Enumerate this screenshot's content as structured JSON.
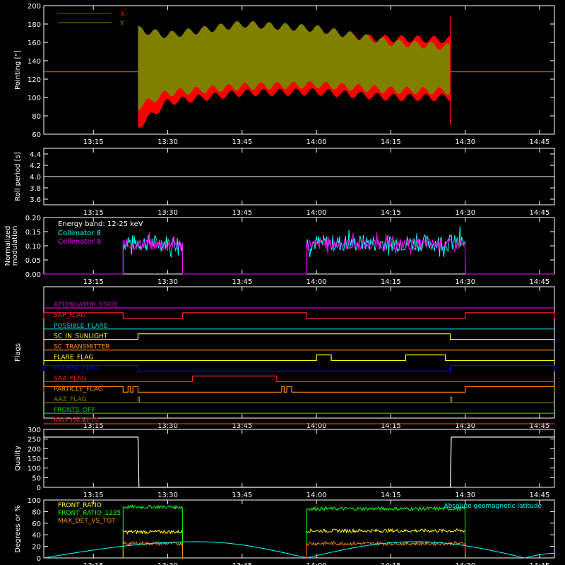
{
  "x_ticks": [
    "13:15",
    "13:30",
    "13:45",
    "14:00",
    "14:15",
    "14:30",
    "14:45"
  ],
  "chart_data": [
    {
      "type": "line",
      "ylabel": "Pointing [\"]",
      "xlim": [
        "13:05",
        "14:48"
      ],
      "ylim": [
        60,
        200
      ],
      "yticks": [
        60,
        80,
        100,
        120,
        140,
        160,
        180,
        200
      ],
      "legend_position": "top-left",
      "series": [
        {
          "name": "X",
          "color": "#ff0000",
          "baseline": 128,
          "active": [
            "13:24",
            "14:27"
          ],
          "envelope_upper": [
            [
              13.4,
              150
            ],
            [
              13.5,
              160
            ],
            [
              13.75,
              166
            ],
            [
              14.0,
              166
            ],
            [
              14.25,
              164
            ],
            [
              14.45,
              163
            ]
          ],
          "envelope_lower": [
            [
              13.4,
              68
            ],
            [
              13.5,
              95
            ],
            [
              13.75,
              105
            ],
            [
              14.0,
              106
            ],
            [
              14.25,
              100
            ],
            [
              14.45,
              100
            ]
          ]
        },
        {
          "name": "Y",
          "color": "#808000",
          "baseline": 128,
          "active": [
            "13:24",
            "14:27"
          ],
          "envelope_upper": [
            [
              13.4,
              174
            ],
            [
              13.5,
              168
            ],
            [
              13.75,
              180
            ],
            [
              14.0,
              175
            ],
            [
              14.25,
              160
            ],
            [
              14.45,
              155
            ]
          ],
          "envelope_lower": [
            [
              13.4,
              90
            ],
            [
              13.5,
              105
            ],
            [
              13.75,
              112
            ],
            [
              14.0,
              114
            ],
            [
              14.25,
              108
            ],
            [
              14.45,
              107
            ]
          ]
        }
      ]
    },
    {
      "type": "line",
      "ylabel": "Roll period [s]",
      "ylim": [
        3.5,
        4.5
      ],
      "yticks": [
        3.6,
        3.8,
        4.0,
        4.2,
        4.4
      ],
      "series": [
        {
          "name": "",
          "color": "#ffffff",
          "x": [
            "13:05",
            "14:48"
          ],
          "y": [
            4.0,
            4.0
          ]
        }
      ]
    },
    {
      "type": "line",
      "ylabel": "Normalized modulation",
      "ylim": [
        0,
        0.2
      ],
      "yticks": [
        0.0,
        0.05,
        0.1,
        0.15,
        0.2
      ],
      "annotation": "Energy band: 12-25 keV",
      "series": [
        {
          "name": "Collimator 8",
          "color": "#00ffff",
          "segments": [
            [
              "13:21",
              "13:33"
            ],
            [
              "13:58",
              "14:30"
            ]
          ],
          "level": 0.11,
          "spread": 0.03
        },
        {
          "name": "Collimator 9",
          "color": "#ff00ff",
          "segments": [
            [
              "13:21",
              "13:33"
            ],
            [
              "13:58",
              "14:30"
            ]
          ],
          "level": 0.105,
          "spread": 0.02
        }
      ]
    },
    {
      "type": "line",
      "ylabel": "Flags",
      "flags": [
        {
          "name": "ATTENUATOR_STATE",
          "color": "#cc00cc",
          "high": []
        },
        {
          "name": "SAP_FLAG",
          "color": "#ff2222",
          "high": [
            [
              "13:05",
              "13:21"
            ],
            [
              "13:33",
              "13:58"
            ],
            [
              "14:30",
              "14:48"
            ]
          ]
        },
        {
          "name": "POSSIBLE_FLARE",
          "color": "#00cccc",
          "high": []
        },
        {
          "name": "SC_IN_SUNLIGHT",
          "color": "#ffff00",
          "high": [
            [
              "13:24",
              "14:27"
            ]
          ]
        },
        {
          "name": "SC_TRANSMITTER",
          "color": "#ff8800",
          "high": []
        },
        {
          "name": "FLARE_FLAG",
          "color": "#ffff00",
          "high": [
            [
              "14:00",
              "14:03"
            ],
            [
              "14:18",
              "14:26"
            ]
          ]
        },
        {
          "name": "ECLIPSE_FLAG",
          "color": "#0000ff",
          "high": [
            [
              "13:05",
              "13:24"
            ],
            [
              "14:27",
              "14:48"
            ]
          ]
        },
        {
          "name": "SAA_FLAG",
          "color": "#ff2222",
          "high": [
            [
              "13:35",
              "13:52"
            ]
          ]
        },
        {
          "name": "PARTICLE_FLAG",
          "color": "#ff8800",
          "high": [
            [
              "13:05",
              "13:21"
            ],
            [
              "13:22",
              "13:22.5"
            ],
            [
              "13:23",
              "13:24"
            ],
            [
              "13:53",
              "13:53.5"
            ],
            [
              "13:54",
              "13:55"
            ],
            [
              "14:30",
              "14:48"
            ]
          ]
        },
        {
          "name": "AAZ_FLAG",
          "color": "#808000",
          "high": [
            [
              "13:24",
              "13:24.3"
            ],
            [
              "14:27",
              "14:27.3"
            ]
          ]
        },
        {
          "name": "FRONTS_OFF",
          "color": "#00cc00",
          "high": []
        },
        {
          "name": "BAD_PACKETS",
          "color": "#ff2222",
          "high": []
        }
      ]
    },
    {
      "type": "line",
      "ylabel": "Quality",
      "ylim": [
        0,
        300
      ],
      "yticks": [
        0,
        50,
        100,
        150,
        200,
        250,
        300
      ],
      "series": [
        {
          "name": "",
          "color": "#ffffff",
          "x": [
            "13:05",
            "13:24",
            "13:24.2",
            "14:27",
            "14:27.2",
            "14:48"
          ],
          "y": [
            260,
            260,
            0,
            0,
            260,
            260
          ]
        }
      ]
    },
    {
      "type": "line",
      "ylabel": "Degrees or %",
      "ylim": [
        0,
        100
      ],
      "yticks": [
        0,
        20,
        40,
        60,
        80,
        100
      ],
      "legend_position": "top-left",
      "annotation": "Absolute geomagnetic latitude",
      "series": [
        {
          "name": "FRONT_RATIO",
          "color": "#ffff00",
          "segments": [
            [
              "13:21",
              "13:33"
            ],
            [
              "13:58",
              "14:30"
            ]
          ],
          "levels": [
            45,
            47
          ]
        },
        {
          "name": "FRONT_RATIO_1225",
          "color": "#00ff00",
          "segments": [
            [
              "13:21",
              "13:33"
            ],
            [
              "13:58",
              "14:30"
            ]
          ],
          "levels": [
            88,
            85
          ]
        },
        {
          "name": "MAX_DET_VS_TOT",
          "color": "#ff8800",
          "segments": [
            [
              "13:21",
              "13:33"
            ],
            [
              "13:58",
              "14:30"
            ]
          ],
          "levels": [
            25,
            25
          ]
        },
        {
          "name": "Absolute geomagnetic latitude",
          "color": "#00ffff",
          "x": [
            "13:05",
            "13:36",
            "13:58",
            "14:20",
            "14:42",
            "14:48"
          ],
          "y": [
            0,
            28,
            0,
            28,
            0,
            8
          ]
        }
      ]
    }
  ]
}
